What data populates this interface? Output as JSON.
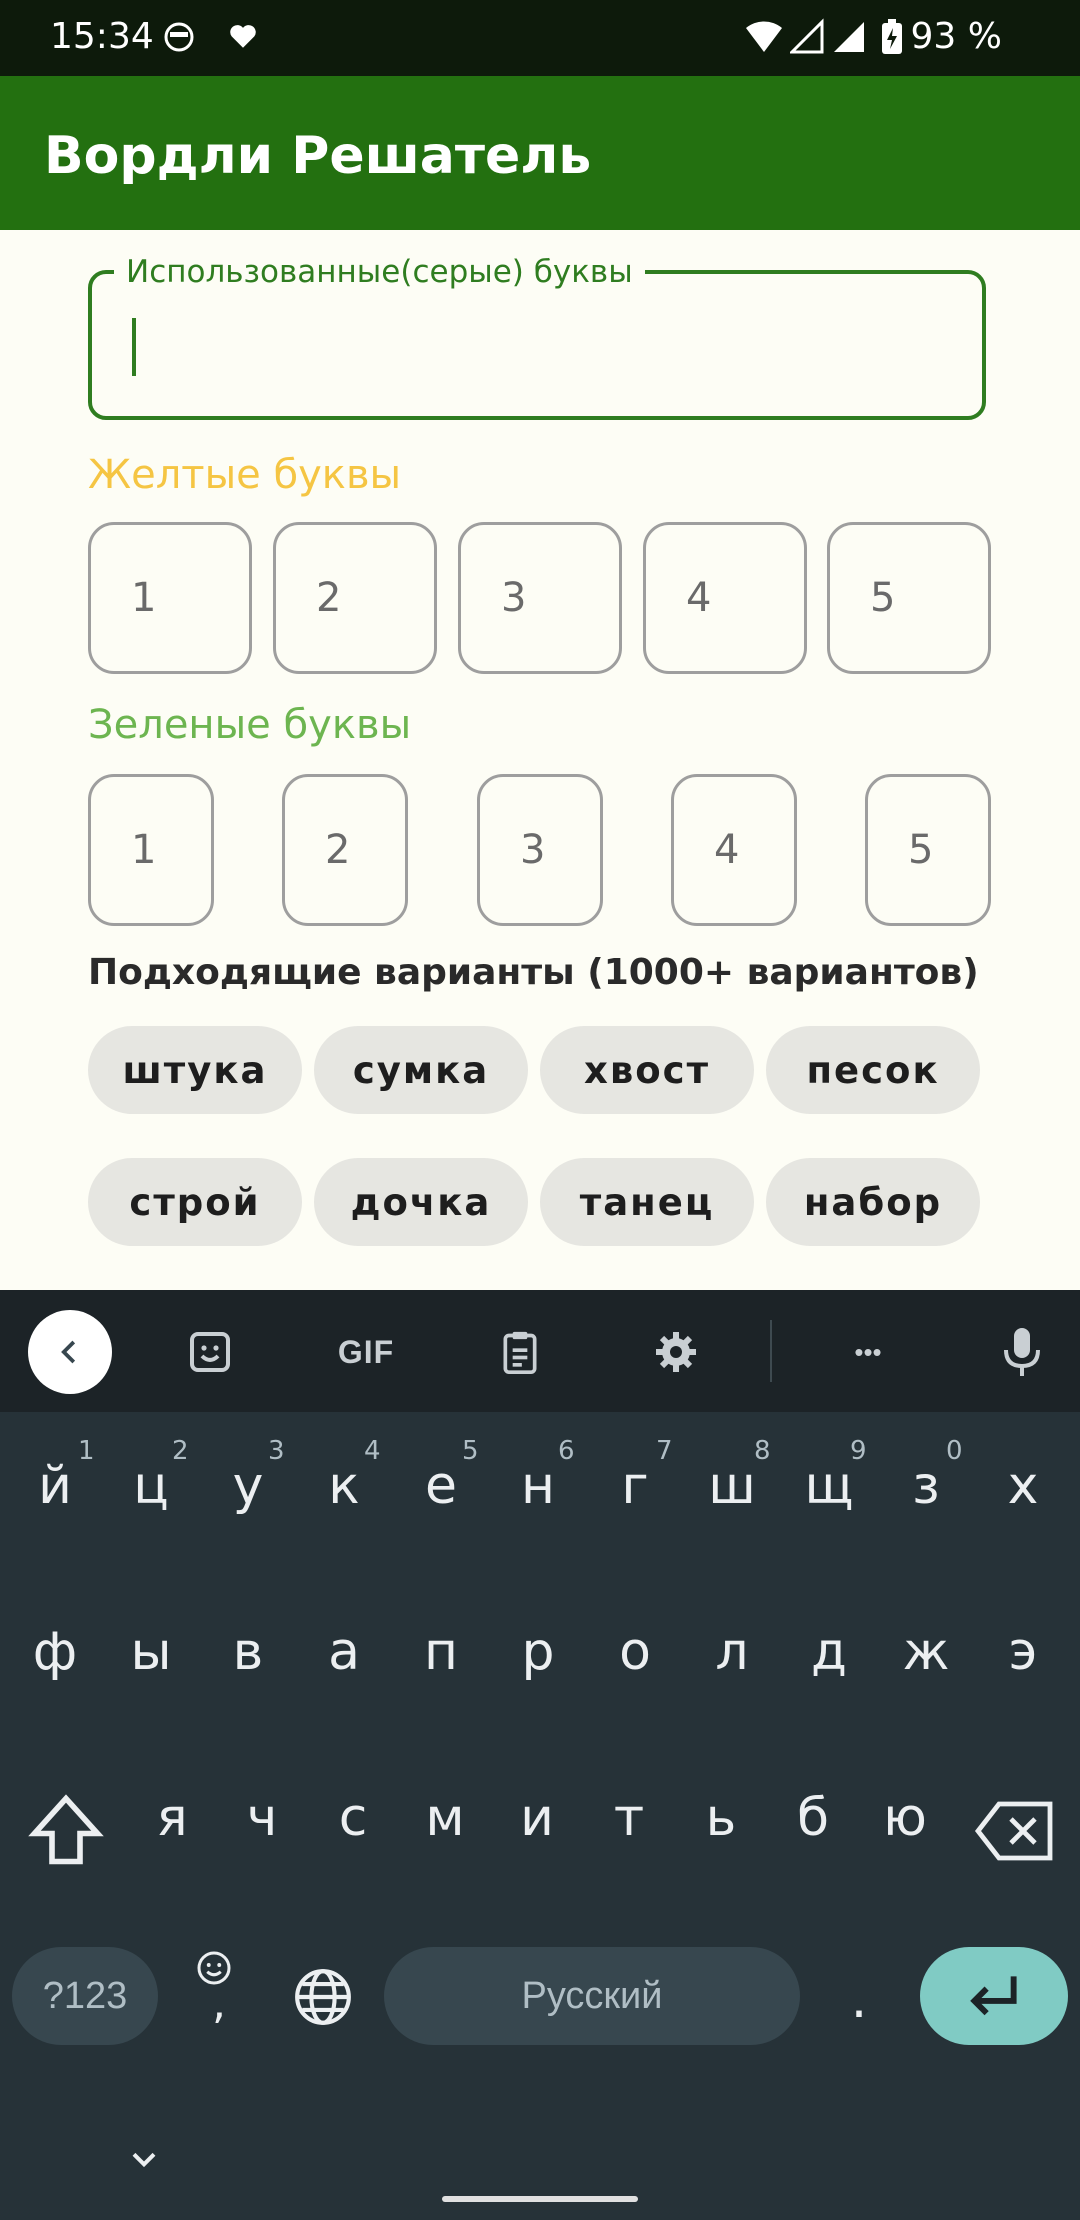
{
  "status_bar": {
    "time": "15:34",
    "battery_percent": "93 %",
    "icons": [
      "face-icon",
      "heart-icon",
      "wifi-icon",
      "signal-icon",
      "signal-icon",
      "battery-charging-icon"
    ]
  },
  "app_bar": {
    "title": "Вордли Решатель"
  },
  "used_letters_field": {
    "label": "Использованные(серые) буквы",
    "value": ""
  },
  "yellow_section": {
    "label": "Желтые буквы",
    "placeholders": [
      "1",
      "2",
      "3",
      "4",
      "5"
    ]
  },
  "green_section": {
    "label": "Зеленые буквы",
    "placeholders": [
      "1",
      "2",
      "3",
      "4",
      "5"
    ]
  },
  "results": {
    "label": "Подходящие варианты (1000+ вариантов)",
    "words": [
      "штука",
      "сумка",
      "хвост",
      "песок",
      "строй",
      "дочка",
      "танец",
      "набор"
    ]
  },
  "keyboard": {
    "toolbar_icons": [
      "back-chevron-icon",
      "sticker-icon",
      "gif-icon",
      "clipboard-icon",
      "settings-icon",
      "more-icon",
      "microphone-icon"
    ],
    "gif_label": "GIF",
    "more_label": "•••",
    "row1": [
      "й",
      "ц",
      "у",
      "к",
      "е",
      "н",
      "г",
      "ш",
      "щ",
      "з",
      "х"
    ],
    "row1_hints": [
      "1",
      "2",
      "3",
      "4",
      "5",
      "6",
      "7",
      "8",
      "9",
      "0"
    ],
    "row2": [
      "ф",
      "ы",
      "в",
      "а",
      "п",
      "р",
      "о",
      "л",
      "д",
      "ж",
      "э"
    ],
    "row3": [
      "я",
      "ч",
      "с",
      "м",
      "и",
      "т",
      "ь",
      "б",
      "ю"
    ],
    "symbols_label": "?123",
    "comma_label": ",",
    "space_label": "Русский",
    "period_label": ".",
    "colors": {
      "accent": "#80cbc4",
      "key_bg": "#37474f",
      "background": "#263238"
    }
  },
  "theme": {
    "primary": "#237010",
    "yellow": "#f5c543",
    "green": "#6db550"
  }
}
